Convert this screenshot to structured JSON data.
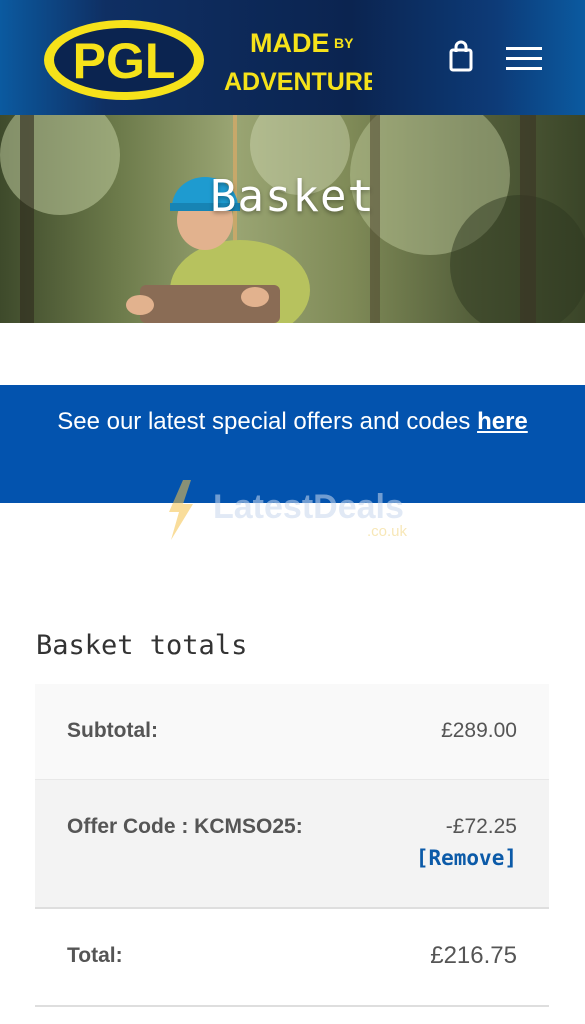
{
  "header": {
    "logo_text": "PGL",
    "tagline_line1": "MADE",
    "tagline_by": "BY",
    "tagline_line2": "ADVENTURE",
    "brand_yellow": "#f6e21a",
    "brand_navy": "#0b2450"
  },
  "hero": {
    "title": "Basket"
  },
  "offers_banner": {
    "text": "See our latest special offers and codes",
    "link_text": "here",
    "background": "#0353ae"
  },
  "watermark": {
    "text": "LatestDeals",
    "suffix": ".co.uk"
  },
  "basket_totals": {
    "heading": "Basket totals",
    "subtotal_label": "Subtotal:",
    "subtotal_value": "£289.00",
    "offer_label": "Offer Code : KCMSO25:",
    "offer_value": "-£72.25",
    "remove_label": "[Remove]",
    "total_label": "Total:",
    "total_value": "£216.75"
  },
  "icons": {
    "cart": "shopping-bag-icon",
    "menu": "hamburger-menu-icon"
  }
}
